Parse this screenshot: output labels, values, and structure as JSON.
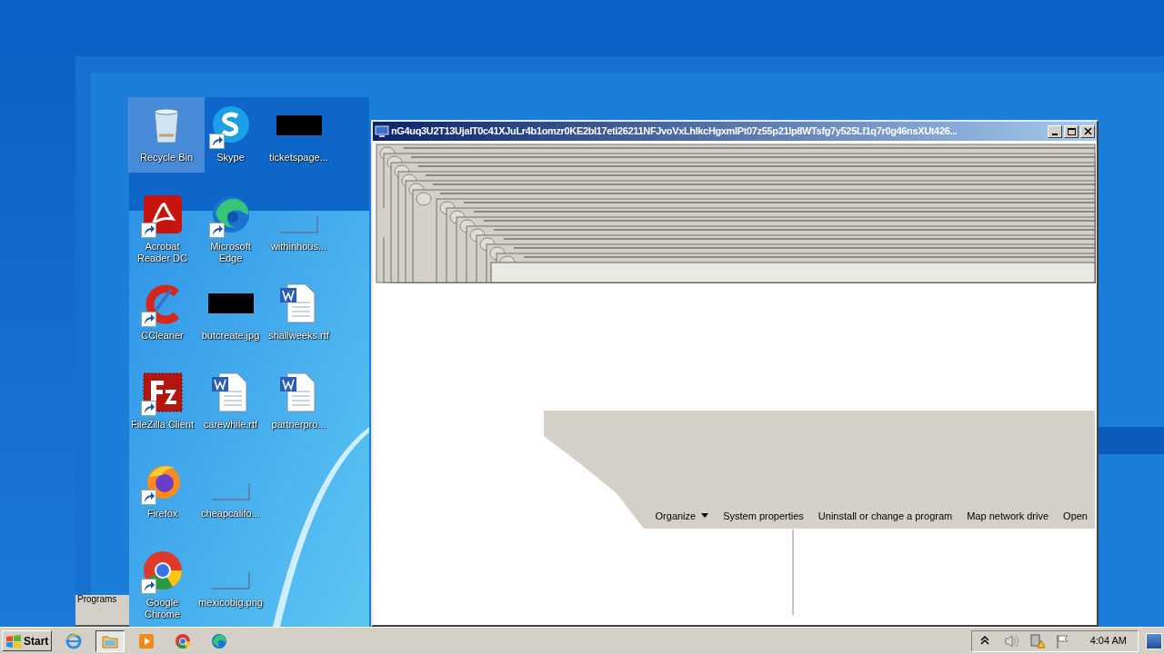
{
  "desktop": {
    "icons": [
      {
        "label": "Recycle Bin",
        "kind": "recycle",
        "selected": true,
        "shortcut": false
      },
      {
        "label": "Acrobat Reader DC",
        "kind": "acrobat",
        "selected": false,
        "shortcut": true
      },
      {
        "label": "CCleaner",
        "kind": "ccleaner",
        "selected": false,
        "shortcut": true
      },
      {
        "label": "FileZilla Client",
        "kind": "filezilla",
        "selected": false,
        "shortcut": true
      },
      {
        "label": "Firefox",
        "kind": "firefox",
        "selected": false,
        "shortcut": true
      },
      {
        "label": "Google Chrome",
        "kind": "chrome",
        "selected": false,
        "shortcut": true
      },
      {
        "label": "Skype",
        "kind": "skype",
        "selected": false,
        "shortcut": true
      },
      {
        "label": "Microsoft Edge",
        "kind": "edge",
        "selected": false,
        "shortcut": true
      },
      {
        "label": "butcreate.jpg",
        "kind": "hidden-thumb",
        "selected": false,
        "shortcut": false
      },
      {
        "label": "carewhile.rtf",
        "kind": "document",
        "selected": false,
        "shortcut": false
      },
      {
        "label": "cheapcalifo...",
        "kind": "blank-thumb",
        "selected": false,
        "shortcut": false
      },
      {
        "label": "mexicobig.png",
        "kind": "blank-thumb",
        "selected": false,
        "shortcut": false
      },
      {
        "label": "ticketspage...",
        "kind": "hidden-thumb",
        "selected": false,
        "shortcut": false
      },
      {
        "label": "withinhous...",
        "kind": "blank-thumb",
        "selected": false,
        "shortcut": false
      },
      {
        "label": "shallweeks.rtf",
        "kind": "document",
        "selected": false,
        "shortcut": false
      },
      {
        "label": "partnerpro...",
        "kind": "document",
        "selected": false,
        "shortcut": false
      }
    ],
    "stray_panel": {
      "label": "Programs"
    }
  },
  "window": {
    "title": "nG4uq3U2T13UjaIT0c41XJuLr4b1omzr0KE2bI17eti26211NFJvoVxLhIkcHgxmIPt07z55p21lp8WTsfg7y525Lf1q7r0g46nsXUt426...",
    "toolbar": [
      {
        "label": "Organize",
        "kind": "menu"
      },
      {
        "label": "System properties",
        "kind": "button"
      },
      {
        "label": "Uninstall or change a program",
        "kind": "button"
      },
      {
        "label": "Map network drive",
        "kind": "button"
      },
      {
        "label": "Open",
        "kind": "button"
      }
    ]
  },
  "taskbar": {
    "start": "Start",
    "items": [
      {
        "kind": "ie",
        "active": false
      },
      {
        "kind": "explorer",
        "active": true
      },
      {
        "kind": "media",
        "active": false
      },
      {
        "kind": "chrome",
        "active": false
      },
      {
        "kind": "edge",
        "active": false
      }
    ],
    "tray": [
      {
        "kind": "chevron"
      },
      {
        "kind": "speaker"
      },
      {
        "kind": "network-warning"
      },
      {
        "kind": "flag"
      }
    ],
    "clock": "4:04 AM"
  }
}
